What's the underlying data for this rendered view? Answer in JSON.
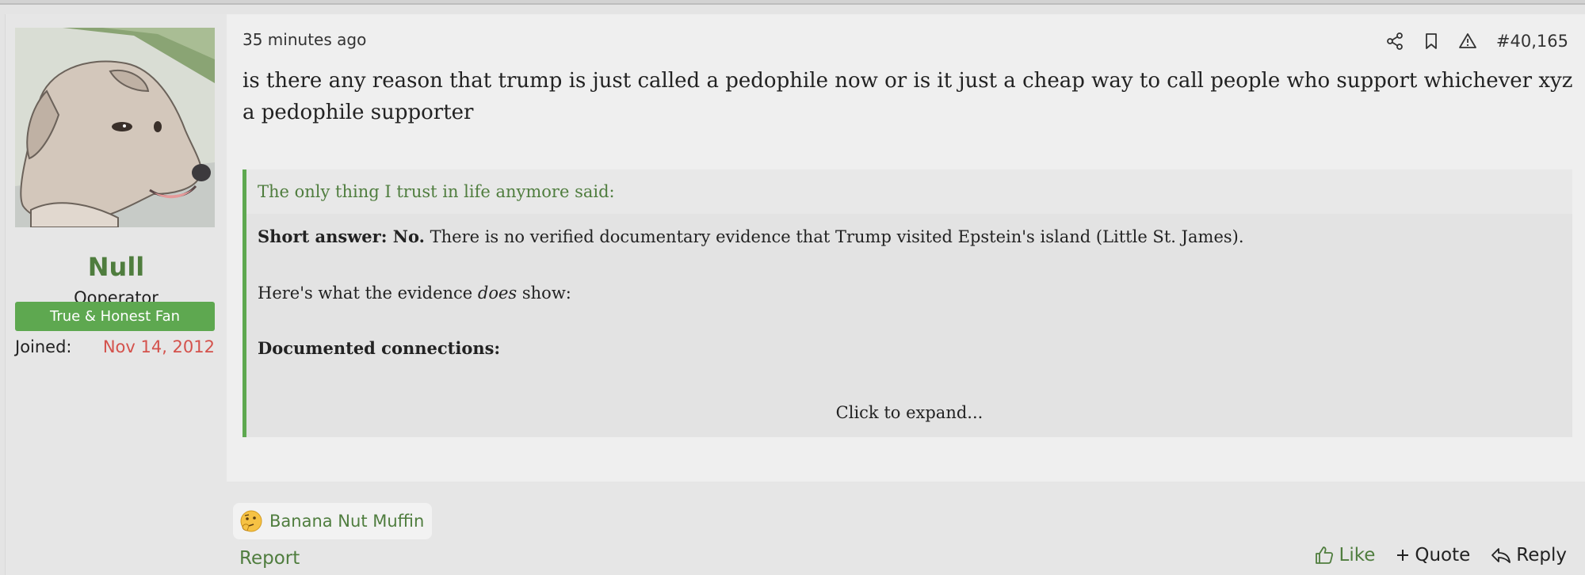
{
  "post": {
    "time": "35 minutes ago",
    "number": "#40,165",
    "body": "is there any reason that trump is just called a pedophile now or is it just a cheap way to call people who support whichever xyz a pedophile supporter",
    "icons": [
      "share-icon",
      "bookmark-icon",
      "warning-icon"
    ]
  },
  "user": {
    "name": "Null",
    "title": "Ooperator",
    "banner": "True & Honest Fan",
    "joined_label": "Joined:",
    "joined_value": "Nov 14, 2012"
  },
  "quote": {
    "header": "The only thing I trust in life anymore said:",
    "p1_bold": "Short answer: No.",
    "p1_rest": " There is no verified documentary evidence that Trump visited Epstein's island (Little St. James).",
    "p2_pre": "Here's what the evidence ",
    "p2_em": "does",
    "p2_post": " show:",
    "p3_bold": "Documented connections:",
    "expand": "Click to expand..."
  },
  "reactions": {
    "emoji": "thinking-face-icon",
    "name": "Banana Nut Muffin"
  },
  "footer": {
    "report": "Report",
    "like": "Like",
    "quote": "Quote",
    "reply": "Reply"
  },
  "colors": {
    "accent_green": "#4f7d3e",
    "banner_green": "#5ea850",
    "joined_red": "#d4524c"
  }
}
